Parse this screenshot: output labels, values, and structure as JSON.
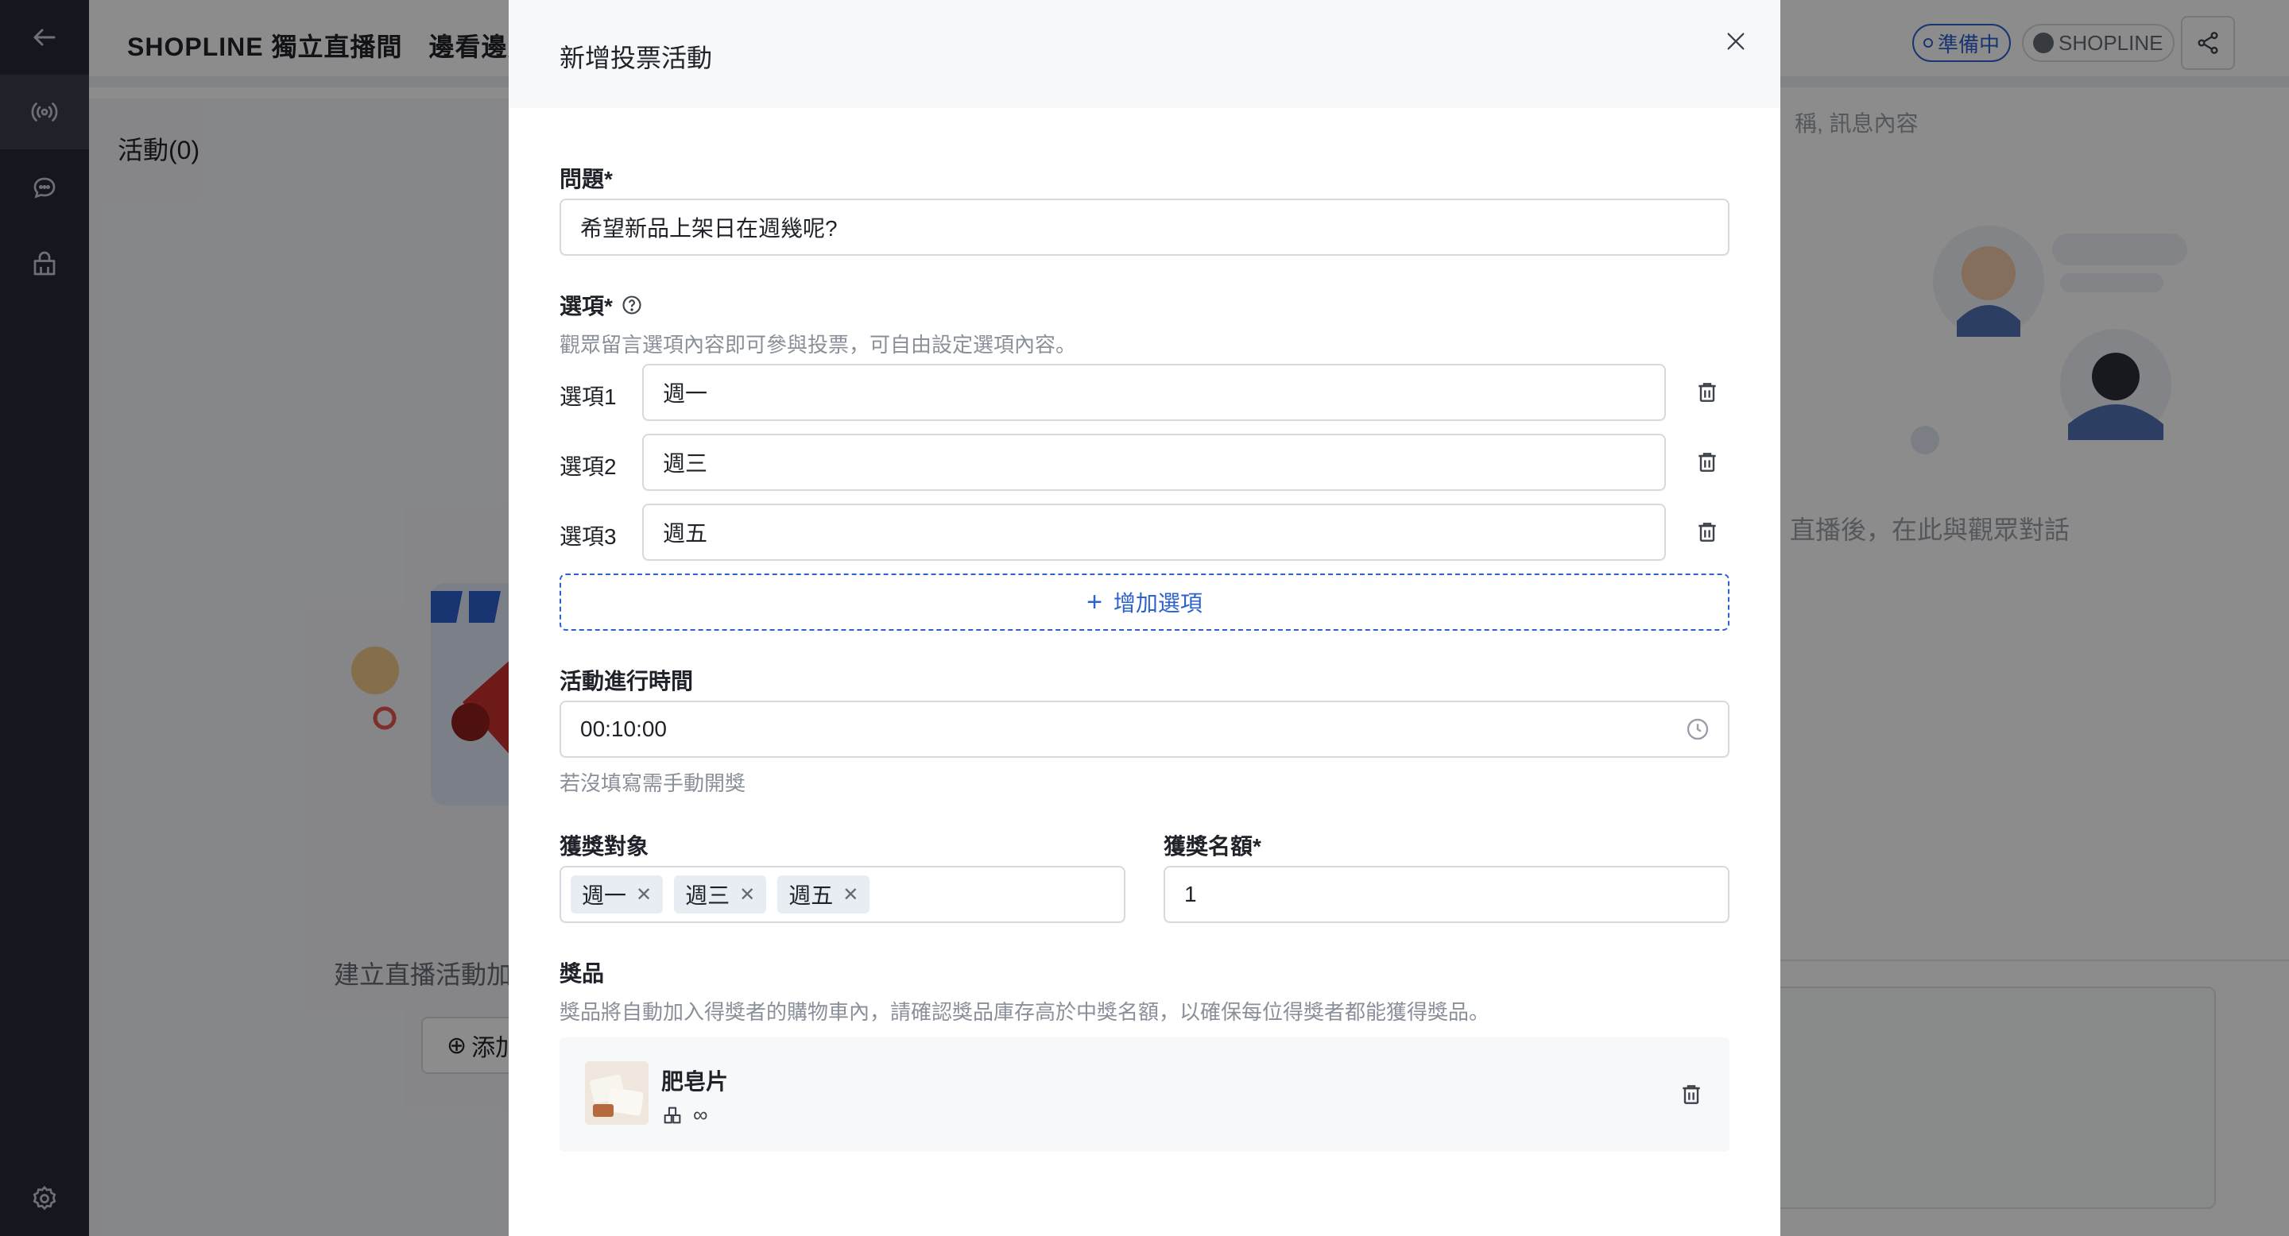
{
  "app": {
    "title": "SHOPLINE 獨立直播間　邊看邊買",
    "status": "準備中",
    "brand": "SHOPLINE",
    "activity_tab": "活動(0)",
    "left_empty_text": "建立直播活動加",
    "left_add_button": "添加",
    "search_hint": "稱, 訊息內容",
    "right_empty_text": "直播後，在此與觀眾對話"
  },
  "nav": {
    "icons": [
      "back-arrow-icon",
      "broadcast-icon",
      "chat-icon",
      "shop-icon",
      "gear-icon"
    ]
  },
  "modal": {
    "title": "新增投票活動",
    "question": {
      "label": "問題*",
      "value": "希望新品上架日在週幾呢?"
    },
    "options": {
      "label": "選項*",
      "hint": "觀眾留言選項內容即可參與投票，可自由設定選項內容。",
      "items": [
        {
          "label": "選項1",
          "value": "週一"
        },
        {
          "label": "選項2",
          "value": "週三"
        },
        {
          "label": "選項3",
          "value": "週五"
        }
      ],
      "add_label": "增加選項"
    },
    "duration": {
      "label": "活動進行時間",
      "value": "00:10:00",
      "hint": "若沒填寫需手動開獎"
    },
    "winner_target": {
      "label": "獲獎對象",
      "tags": [
        "週一",
        "週三",
        "週五"
      ]
    },
    "winner_count": {
      "label": "獲獎名額*",
      "value": "1"
    },
    "prize": {
      "label": "獎品",
      "hint": "獎品將自動加入得獎者的購物車內，請確認獎品庫存高於中獎名額，以確保每位得獎者都能獲得獎品。",
      "product_name": "肥皂片",
      "stock": "∞"
    }
  },
  "colors": {
    "accent": "#2d62ce",
    "nav_bg": "#262b36"
  }
}
